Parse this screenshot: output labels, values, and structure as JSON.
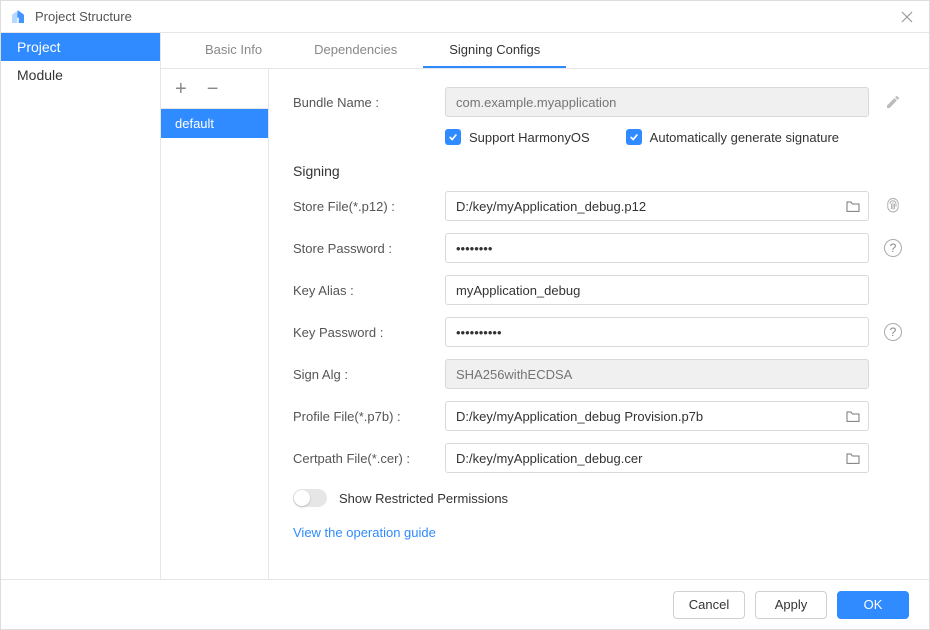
{
  "window": {
    "title": "Project Structure"
  },
  "leftNav": {
    "items": [
      {
        "label": "Project",
        "active": true
      },
      {
        "label": "Module",
        "active": false
      }
    ]
  },
  "tabs": [
    {
      "label": "Basic Info",
      "active": false
    },
    {
      "label": "Dependencies",
      "active": false
    },
    {
      "label": "Signing Configs",
      "active": true
    }
  ],
  "configs": {
    "items": [
      {
        "label": "default",
        "active": true
      }
    ]
  },
  "form": {
    "bundleName": {
      "label": "Bundle Name :",
      "placeholder": "com.example.myapplication"
    },
    "supportHarmony": {
      "label": "Support HarmonyOS",
      "checked": true
    },
    "autoGenerate": {
      "label": "Automatically generate signature",
      "checked": true
    },
    "signingHeader": "Signing",
    "storeFile": {
      "label": "Store File(*.p12) :",
      "value": "D:/key/myApplication_debug.p12"
    },
    "storePassword": {
      "label": "Store Password :",
      "value": "••••••••"
    },
    "keyAlias": {
      "label": "Key Alias :",
      "value": "myApplication_debug"
    },
    "keyPassword": {
      "label": "Key Password :",
      "value": "••••••••••"
    },
    "signAlg": {
      "label": "Sign Alg :",
      "placeholder": "SHA256withECDSA"
    },
    "profileFile": {
      "label": "Profile File(*.p7b) :",
      "value": "D:/key/myApplication_debug Provision.p7b"
    },
    "certpathFile": {
      "label": "Certpath File(*.cer) :",
      "value": "D:/key/myApplication_debug.cer"
    },
    "restrictedToggle": {
      "label": "Show Restricted Permissions",
      "on": false
    },
    "guideLink": "View the operation guide"
  },
  "footer": {
    "cancel": "Cancel",
    "apply": "Apply",
    "ok": "OK"
  }
}
